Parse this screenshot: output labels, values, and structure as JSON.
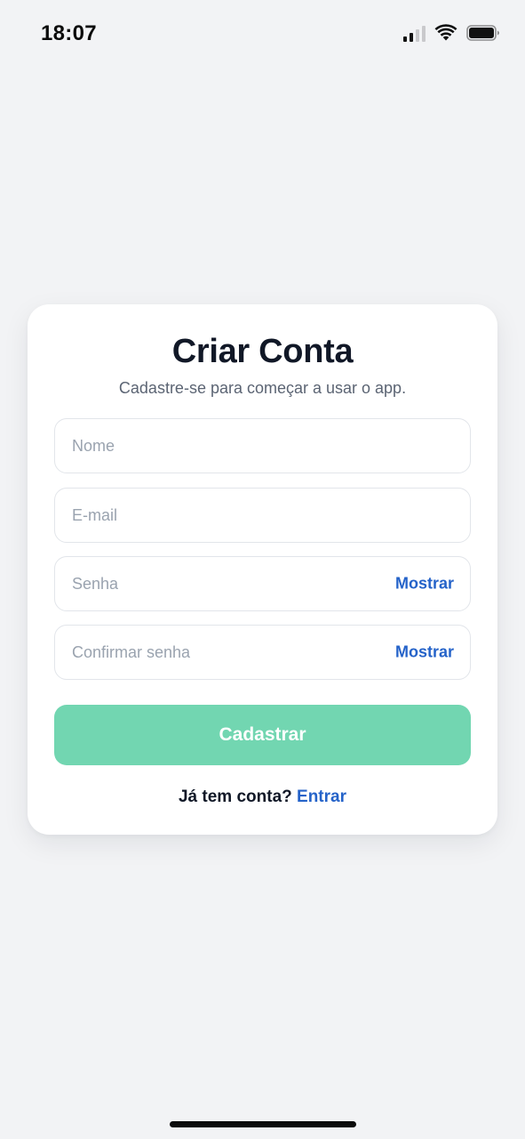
{
  "status_bar": {
    "time": "18:07",
    "icons": [
      "signal-icon",
      "wifi-icon",
      "battery-icon"
    ]
  },
  "form": {
    "title": "Criar Conta",
    "subtitle": "Cadastre-se para começar a usar o app.",
    "fields": [
      {
        "name": "name",
        "placeholder": "Nome",
        "value": ""
      },
      {
        "name": "email",
        "placeholder": "E-mail",
        "value": ""
      },
      {
        "name": "password",
        "placeholder": "Senha",
        "value": "",
        "action": "Mostrar"
      },
      {
        "name": "confirm-password",
        "placeholder": "Confirmar senha",
        "value": "",
        "action": "Mostrar"
      }
    ],
    "submit_label": "Cadastrar",
    "footer_text": "Já tem conta?",
    "footer_link": "Entrar"
  },
  "colors": {
    "background": "#f2f3f5",
    "card": "#ffffff",
    "primary_button": "#72d6b1",
    "link": "#2563c9",
    "title": "#111827"
  }
}
